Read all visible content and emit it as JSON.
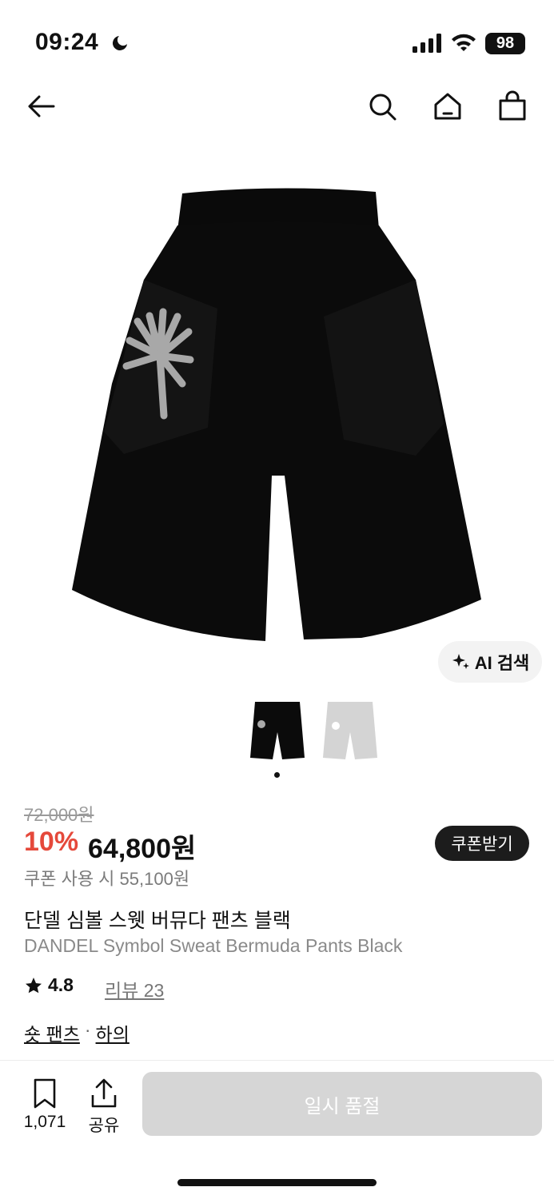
{
  "status": {
    "time": "09:24",
    "battery": "98"
  },
  "nav": {
    "back": "back-arrow-icon",
    "search": "search-icon",
    "home": "home-icon",
    "cart": "shopping-bag-icon"
  },
  "ai": {
    "label": "AI 검색"
  },
  "thumbnails": [
    "black",
    "gray"
  ],
  "price": {
    "original": "72,000원",
    "discount": "10%",
    "current": "64,800원",
    "coupon_text": "쿠폰 사용 시 55,100원",
    "coupon_button": "쿠폰받기"
  },
  "product": {
    "name_ko": "단델 심볼 스웻 버뮤다 팬츠 블랙",
    "name_en": "DANDEL Symbol Sweat Bermuda Pants Black"
  },
  "rating": {
    "score": "4.8",
    "review_text": "리뷰 23"
  },
  "category": {
    "primary": "숏 팬츠",
    "separator": "·",
    "secondary": "하의"
  },
  "bottom": {
    "bookmark_count": "1,071",
    "share_label": "공유",
    "soldout_label": "일시 품절"
  },
  "colors": {
    "accent": "#e5493b",
    "soldout": "#d6d6d6",
    "dark": "#1c1c1c"
  }
}
